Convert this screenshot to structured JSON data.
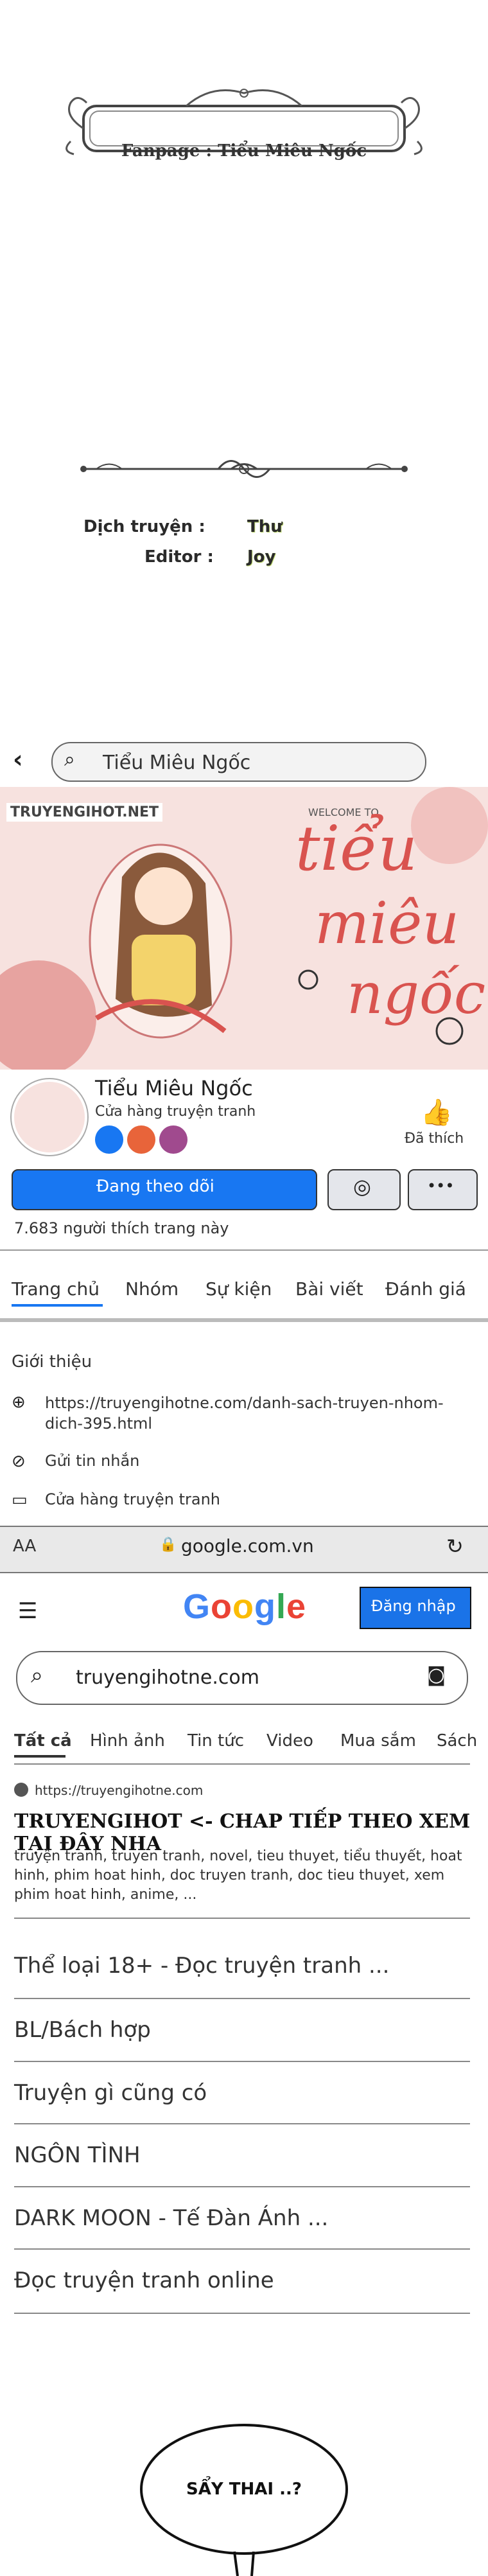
{
  "credits": {
    "fanpage_label": "Fanpage : Tiểu Miêu Ngốc",
    "translator_label": "Dịch truyện :",
    "translator_name": "Thư",
    "editor_label": "Editor :",
    "editor_name": "Joy"
  },
  "facebook": {
    "search_value": "Tiểu Miêu Ngốc",
    "cover_watermark": "TRUYENGIHOT.NET",
    "cover_welcome": "WELCOME TO",
    "cover_title_1": "tiểu",
    "cover_title_2": "miêu",
    "cover_title_3": "ngốc",
    "page_name": "Tiểu Miêu Ngốc",
    "page_category": "Cửa hàng truyện tranh",
    "liked_label": "Đã thích",
    "follow_button": "Đang theo dõi",
    "more_button": "•••",
    "likes_count": "7.683 người thích trang này",
    "tabs": [
      "Trang chủ",
      "Nhóm",
      "Sự kiện",
      "Bài viết",
      "Đánh giá"
    ],
    "about_heading": "Giới thiệu",
    "about_link": "https://truyengihotne.com/danh-sach-truyen-nhom-dich-395.html",
    "send_message": "Gửi tin nhắn",
    "shop": "Cửa hàng truyện tranh"
  },
  "browser": {
    "aa_label": "AA",
    "url": "google.com.vn"
  },
  "google": {
    "logo": "Google",
    "login_button": "Đăng nhập",
    "query": "truyengihotne.com",
    "tabs": [
      "Tất cả",
      "Hình ảnh",
      "Tin tức",
      "Video",
      "Mua sắm",
      "Sách"
    ],
    "result_url": "https://truyengihotne.com",
    "result_title": "TRUYENGIHOT <- CHAP TIẾP THEO XEM TẠI ĐÂY NHA",
    "result_snippet": "truyện tranh, truyen tranh, novel, tieu thuyet, tiểu thuyết, hoat hinh, phim hoat hinh, doc truyen tranh, doc tieu thuyet, xem phim hoat hinh, anime, ...",
    "links": [
      "Thể loại 18+ - Đọc truyện tranh ...",
      "BL/Bách hợp",
      "Truyện gì cũng có",
      "NGÔN TÌNH",
      "DARK MOON - Tế Đàn Ánh ...",
      "Đọc truyện tranh online"
    ]
  },
  "bubble": {
    "text": "SẨY THAI ..?"
  },
  "colors": {
    "fb_blue": "#1877f2",
    "google_blue": "#4285f4",
    "google_red": "#ea4335",
    "google_yellow": "#fbbc05",
    "google_green": "#34a853",
    "cover_pink": "#f7e2df",
    "cover_red": "#d9534f"
  }
}
